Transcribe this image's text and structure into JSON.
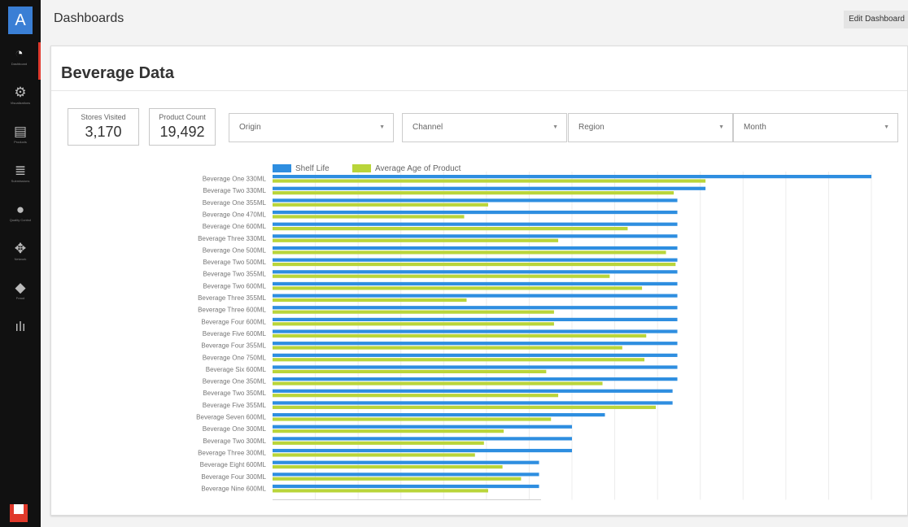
{
  "app": {
    "logo_letter": "A"
  },
  "sidebar": {
    "items": [
      {
        "icon": "gauge-icon",
        "label": "Dashboard",
        "glyph": "◔",
        "active": true
      },
      {
        "icon": "visualization-icon",
        "label": "Visualizations",
        "glyph": "⚙"
      },
      {
        "icon": "products-icon",
        "label": "Products",
        "glyph": "▤"
      },
      {
        "icon": "submissions-icon",
        "label": "Submissions",
        "glyph": "≣"
      },
      {
        "icon": "quality-control-icon",
        "label": "Quality Control",
        "glyph": "●"
      },
      {
        "icon": "network-icon",
        "label": "Network",
        "glyph": "✥"
      },
      {
        "icon": "fraud-icon",
        "label": "Fraud",
        "glyph": "◆"
      },
      {
        "icon": "bar-chart-icon",
        "label": "",
        "glyph": "ılı"
      }
    ]
  },
  "header": {
    "title": "Dashboards",
    "edit_label": "Edit Dashboard"
  },
  "dashboard": {
    "title": "Beverage Data",
    "metrics": [
      {
        "label": "Stores Visited",
        "value": "3,170"
      },
      {
        "label": "Product Count",
        "value": "19,492"
      }
    ],
    "filters": [
      {
        "label": "Origin"
      },
      {
        "label": "Channel"
      },
      {
        "label": "Region"
      },
      {
        "label": "Month"
      }
    ]
  },
  "chart_data": {
    "type": "bar",
    "orientation": "horizontal",
    "legend": "top",
    "grid": true,
    "xlim": [
      0,
      1
    ],
    "categories": [
      "Beverage One 330ML",
      "Beverage Two 330ML",
      "Beverage One 355ML",
      "Beverage One 470ML",
      "Beverage One 600ML",
      "Beverage Three 330ML",
      "Beverage One 500ML",
      "Beverage Two 500ML",
      "Beverage Two 355ML",
      "Beverage Two 600ML",
      "Beverage Three 355ML",
      "Beverage Three 600ML",
      "Beverage Four 600ML",
      "Beverage Five 600ML",
      "Beverage Four 355ML",
      "Beverage One 750ML",
      "Beverage Six 600ML",
      "Beverage One 350ML",
      "Beverage Two 350ML",
      "Beverage Five 355ML",
      "Beverage Seven 600ML",
      "Beverage One 300ML",
      "Beverage Two 300ML",
      "Beverage Three 300ML",
      "Beverage Eight 600ML",
      "Beverage Four 300ML",
      "Beverage Nine 600ML"
    ],
    "series": [
      {
        "name": "Shelf Life",
        "color": "#2e8ee0",
        "values": [
          1.0,
          0.723,
          0.676,
          0.676,
          0.676,
          0.676,
          0.676,
          0.676,
          0.676,
          0.676,
          0.676,
          0.676,
          0.676,
          0.676,
          0.676,
          0.676,
          0.676,
          0.676,
          0.668,
          0.668,
          0.555,
          0.5,
          0.5,
          0.5,
          0.445,
          0.445,
          0.445
        ]
      },
      {
        "name": "Average Age of Product",
        "color": "#b9d53a",
        "values": [
          0.723,
          0.67,
          0.36,
          0.32,
          0.593,
          0.477,
          0.657,
          0.673,
          0.563,
          0.617,
          0.324,
          0.47,
          0.47,
          0.624,
          0.584,
          0.621,
          0.457,
          0.551,
          0.477,
          0.64,
          0.465,
          0.386,
          0.353,
          0.338,
          0.384,
          0.415,
          0.36
        ]
      }
    ]
  }
}
